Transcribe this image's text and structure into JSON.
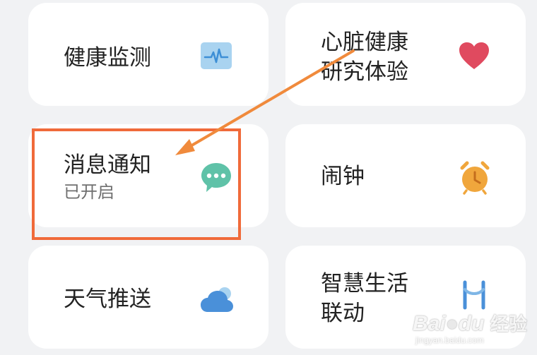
{
  "cards": {
    "health_monitor": {
      "title": "健康监测",
      "icon": "heart-rate-monitor-icon"
    },
    "heart_health": {
      "title_line1": "心脏健康",
      "title_line2": "研究体验",
      "icon": "heart-icon"
    },
    "notifications": {
      "title": "消息通知",
      "status": "已开启",
      "icon": "chat-bubble-icon"
    },
    "alarm": {
      "title": "闹钟",
      "icon": "alarm-clock-icon"
    },
    "weather": {
      "title": "天气推送",
      "icon": "cloud-icon"
    },
    "smart_life": {
      "title_line1": "智慧生活",
      "title_line2": "联动",
      "icon": "smart-link-icon"
    }
  },
  "annotation": {
    "highlight_color": "#f06a3a",
    "arrow_color": "#f08a3c"
  },
  "watermark": {
    "brand_part1": "Bai",
    "brand_part2": "du",
    "brand_part3": "经验",
    "url": "jingyan.baidu.com"
  },
  "colors": {
    "background": "#f1f2f4",
    "card": "#ffffff",
    "heart": "#e04a5f",
    "chat": "#5fc2a8",
    "alarm": "#f0a63c",
    "cloud": "#4a90d9",
    "monitor": "#9ccbeb"
  }
}
